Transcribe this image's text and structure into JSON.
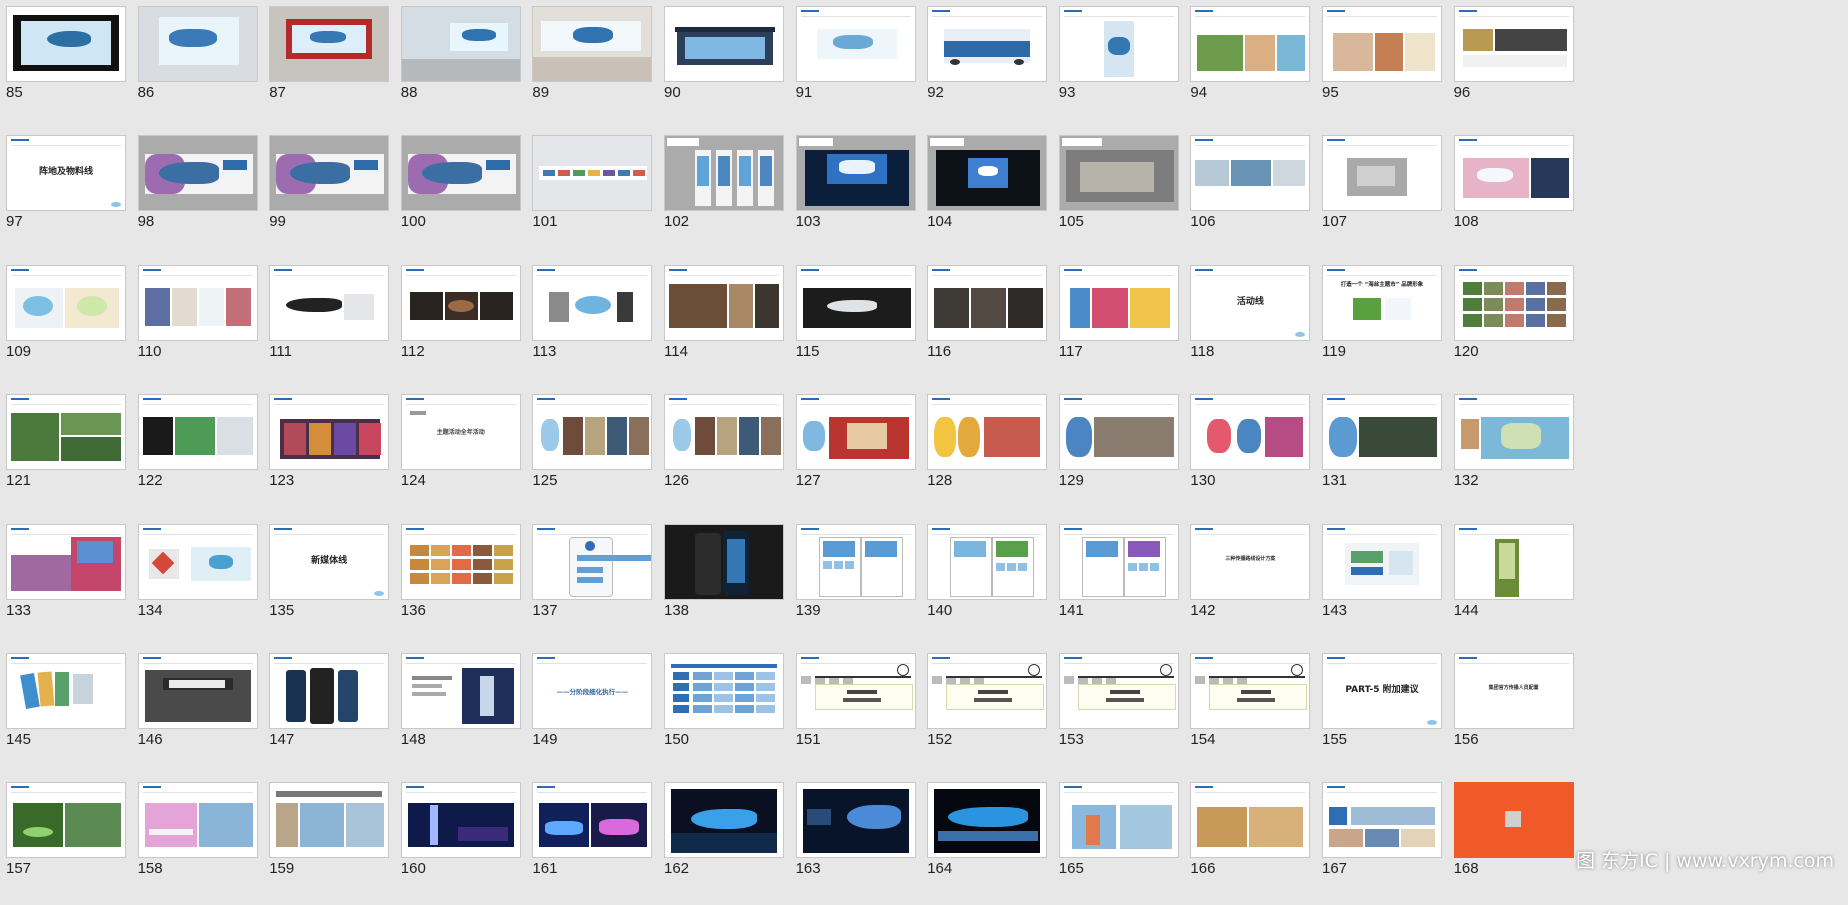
{
  "slides": [
    {
      "n": "85",
      "style": "billboard-dark"
    },
    {
      "n": "86",
      "style": "corridor"
    },
    {
      "n": "87",
      "style": "subway"
    },
    {
      "n": "88",
      "style": "hall"
    },
    {
      "n": "89",
      "style": "mall"
    },
    {
      "n": "90",
      "style": "bus-stop"
    },
    {
      "n": "91",
      "style": "sketch"
    },
    {
      "n": "92",
      "style": "bus"
    },
    {
      "n": "93",
      "style": "tower"
    },
    {
      "n": "94",
      "style": "collage-green"
    },
    {
      "n": "95",
      "style": "food"
    },
    {
      "n": "96",
      "style": "photos-dark"
    },
    {
      "n": "97",
      "style": "title",
      "title": "阵地及物料线"
    },
    {
      "n": "98",
      "style": "banner-gray"
    },
    {
      "n": "99",
      "style": "banner-gray"
    },
    {
      "n": "100",
      "style": "banner-gray"
    },
    {
      "n": "101",
      "style": "light-strip"
    },
    {
      "n": "102",
      "style": "gray-stands"
    },
    {
      "n": "103",
      "style": "stage-blue"
    },
    {
      "n": "104",
      "style": "stage-dark"
    },
    {
      "n": "105",
      "style": "gray-scene"
    },
    {
      "n": "106",
      "style": "tri-photos"
    },
    {
      "n": "107",
      "style": "single-photo"
    },
    {
      "n": "108",
      "style": "pink-photo"
    },
    {
      "n": "109",
      "style": "toys"
    },
    {
      "n": "110",
      "style": "toys-4"
    },
    {
      "n": "111",
      "style": "whale-dark"
    },
    {
      "n": "112",
      "style": "brown-items"
    },
    {
      "n": "113",
      "style": "blue-items"
    },
    {
      "n": "114",
      "style": "collage-brown"
    },
    {
      "n": "115",
      "style": "dark-whale"
    },
    {
      "n": "116",
      "style": "dark-items"
    },
    {
      "n": "117",
      "style": "colorful"
    },
    {
      "n": "118",
      "style": "title",
      "title": "活动线"
    },
    {
      "n": "119",
      "style": "title-logo",
      "title": "打造一个 “海丝主题市” 品牌形象"
    },
    {
      "n": "120",
      "style": "grid-photos"
    },
    {
      "n": "121",
      "style": "park"
    },
    {
      "n": "122",
      "style": "green-mix"
    },
    {
      "n": "123",
      "style": "night-collage"
    },
    {
      "n": "124",
      "style": "text-center",
      "title": "主题活动全年活动"
    },
    {
      "n": "125",
      "style": "mascot-photos"
    },
    {
      "n": "126",
      "style": "mascot-photos"
    },
    {
      "n": "127",
      "style": "mascot-red"
    },
    {
      "n": "128",
      "style": "mascot-yellow"
    },
    {
      "n": "129",
      "style": "mascot-blue"
    },
    {
      "n": "130",
      "style": "mascot-pair"
    },
    {
      "n": "131",
      "style": "mascot-dark"
    },
    {
      "n": "132",
      "style": "map"
    },
    {
      "n": "133",
      "style": "crowd"
    },
    {
      "n": "134",
      "style": "kites"
    },
    {
      "n": "135",
      "style": "title",
      "title": "新媒体线"
    },
    {
      "n": "136",
      "style": "app-grid"
    },
    {
      "n": "137",
      "style": "phone-ui"
    },
    {
      "n": "138",
      "style": "phone-dark"
    },
    {
      "n": "139",
      "style": "app-screens"
    },
    {
      "n": "140",
      "style": "app-screens-green"
    },
    {
      "n": "141",
      "style": "app-screens-purple"
    },
    {
      "n": "142",
      "style": "text-small",
      "title": "三种传播路线设计方案"
    },
    {
      "n": "143",
      "style": "logo-card"
    },
    {
      "n": "144",
      "style": "bamboo"
    },
    {
      "n": "145",
      "style": "cards"
    },
    {
      "n": "146",
      "style": "building-dark"
    },
    {
      "n": "147",
      "style": "phones"
    },
    {
      "n": "148",
      "style": "tower-night"
    },
    {
      "n": "149",
      "style": "text-line",
      "title": "——分阶段细化执行——"
    },
    {
      "n": "150",
      "style": "table-blue"
    },
    {
      "n": "151",
      "style": "timeline"
    },
    {
      "n": "152",
      "style": "timeline"
    },
    {
      "n": "153",
      "style": "timeline"
    },
    {
      "n": "154",
      "style": "timeline"
    },
    {
      "n": "155",
      "style": "title",
      "title": "PART-5 附加建议"
    },
    {
      "n": "156",
      "style": "text-small",
      "title": "集团官方传播人员配置"
    },
    {
      "n": "157",
      "style": "night-park"
    },
    {
      "n": "158",
      "style": "pink-bridge"
    },
    {
      "n": "159",
      "style": "city-day"
    },
    {
      "n": "160",
      "style": "tower-blue"
    },
    {
      "n": "161",
      "style": "lights-blue"
    },
    {
      "n": "162",
      "style": "whale-night"
    },
    {
      "n": "163",
      "style": "lake-night"
    },
    {
      "n": "164",
      "style": "whale-light"
    },
    {
      "n": "165",
      "style": "sculpture"
    },
    {
      "n": "166",
      "style": "street"
    },
    {
      "n": "167",
      "style": "panorama"
    },
    {
      "n": "168",
      "style": "orange"
    }
  ],
  "watermark": "图 东方IC | www.vxrym.com",
  "colors": {
    "background": "#e7e7e7",
    "accent": "#2a6db5",
    "orange": "#ef5a28"
  }
}
